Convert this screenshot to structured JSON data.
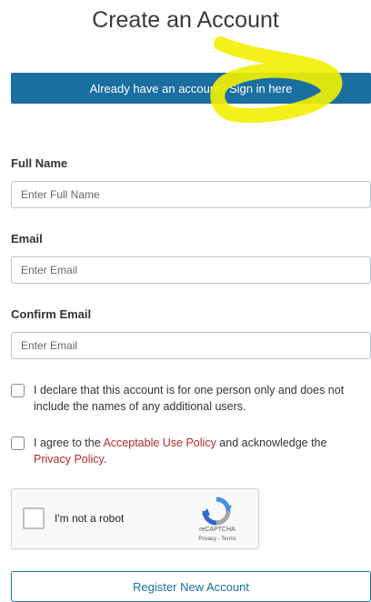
{
  "page": {
    "title": "Create an Account"
  },
  "signin": {
    "prefix": "Already have an account?",
    "link": "Sign in here"
  },
  "form": {
    "full_name": {
      "label": "Full Name",
      "placeholder": "Enter Full Name",
      "value": ""
    },
    "email": {
      "label": "Email",
      "placeholder": "Enter Email",
      "value": ""
    },
    "confirm_email": {
      "label": "Confirm Email",
      "placeholder": "Enter Email",
      "value": ""
    }
  },
  "declaration": {
    "text": "I declare that this account is for one person only and does not include the names of any additional users.",
    "checked": false
  },
  "agreement": {
    "pre": "I agree to the ",
    "aup_link": "Acceptable Use Policy",
    "mid": " and acknowledge the ",
    "privacy_link": "Privacy Policy",
    "post": ".",
    "checked": false
  },
  "captcha": {
    "label": "I'm not a robot",
    "brand": "reCAPTCHA",
    "links": "Privacy - Terms",
    "checked": false
  },
  "register": {
    "label": "Register New Account"
  },
  "colors": {
    "primary": "#1a6ea0",
    "link_red": "#b52a2a",
    "highlight": "#f2f000"
  },
  "icons": {
    "captcha": "recaptcha-logo-icon"
  }
}
